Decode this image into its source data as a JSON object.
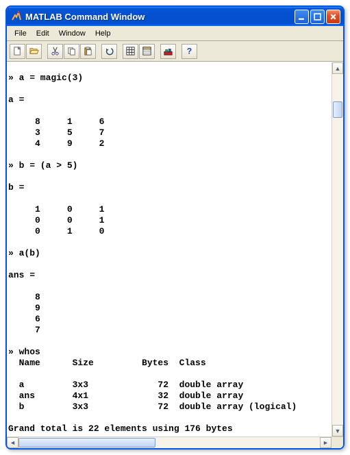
{
  "window": {
    "title": "MATLAB Command Window"
  },
  "menu": {
    "items": [
      "File",
      "Edit",
      "Window",
      "Help"
    ]
  },
  "toolbar": {
    "new": "New",
    "open": "Open",
    "cut": "Cut",
    "copy": "Copy",
    "paste": "Paste",
    "undo": "Undo",
    "workspace": "Workspace",
    "path": "Path Browser",
    "simulink": "Simulink",
    "help": "Help"
  },
  "console_text": "» a = magic(3)\n\na =\n\n     8     1     6\n     3     5     7\n     4     9     2\n\n» b = (a > 5)\n\nb =\n\n     1     0     1\n     0     0     1\n     0     1     0\n\n» a(b)\n\nans =\n\n     8\n     9\n     6\n     7\n\n» whos\n  Name      Size         Bytes  Class\n\n  a         3x3             72  double array\n  ans       4x1             32  double array\n  b         3x3             72  double array (logical)\n\nGrand total is 22 elements using 176 bytes\n\n»",
  "chart_data": {
    "type": "table",
    "title": "whos",
    "columns": [
      "Name",
      "Size",
      "Bytes",
      "Class"
    ],
    "rows": [
      {
        "Name": "a",
        "Size": "3x3",
        "Bytes": 72,
        "Class": "double array"
      },
      {
        "Name": "ans",
        "Size": "4x1",
        "Bytes": 32,
        "Class": "double array"
      },
      {
        "Name": "b",
        "Size": "3x3",
        "Bytes": 72,
        "Class": "double array (logical)"
      }
    ],
    "summary": "Grand total is 22 elements using 176 bytes"
  }
}
